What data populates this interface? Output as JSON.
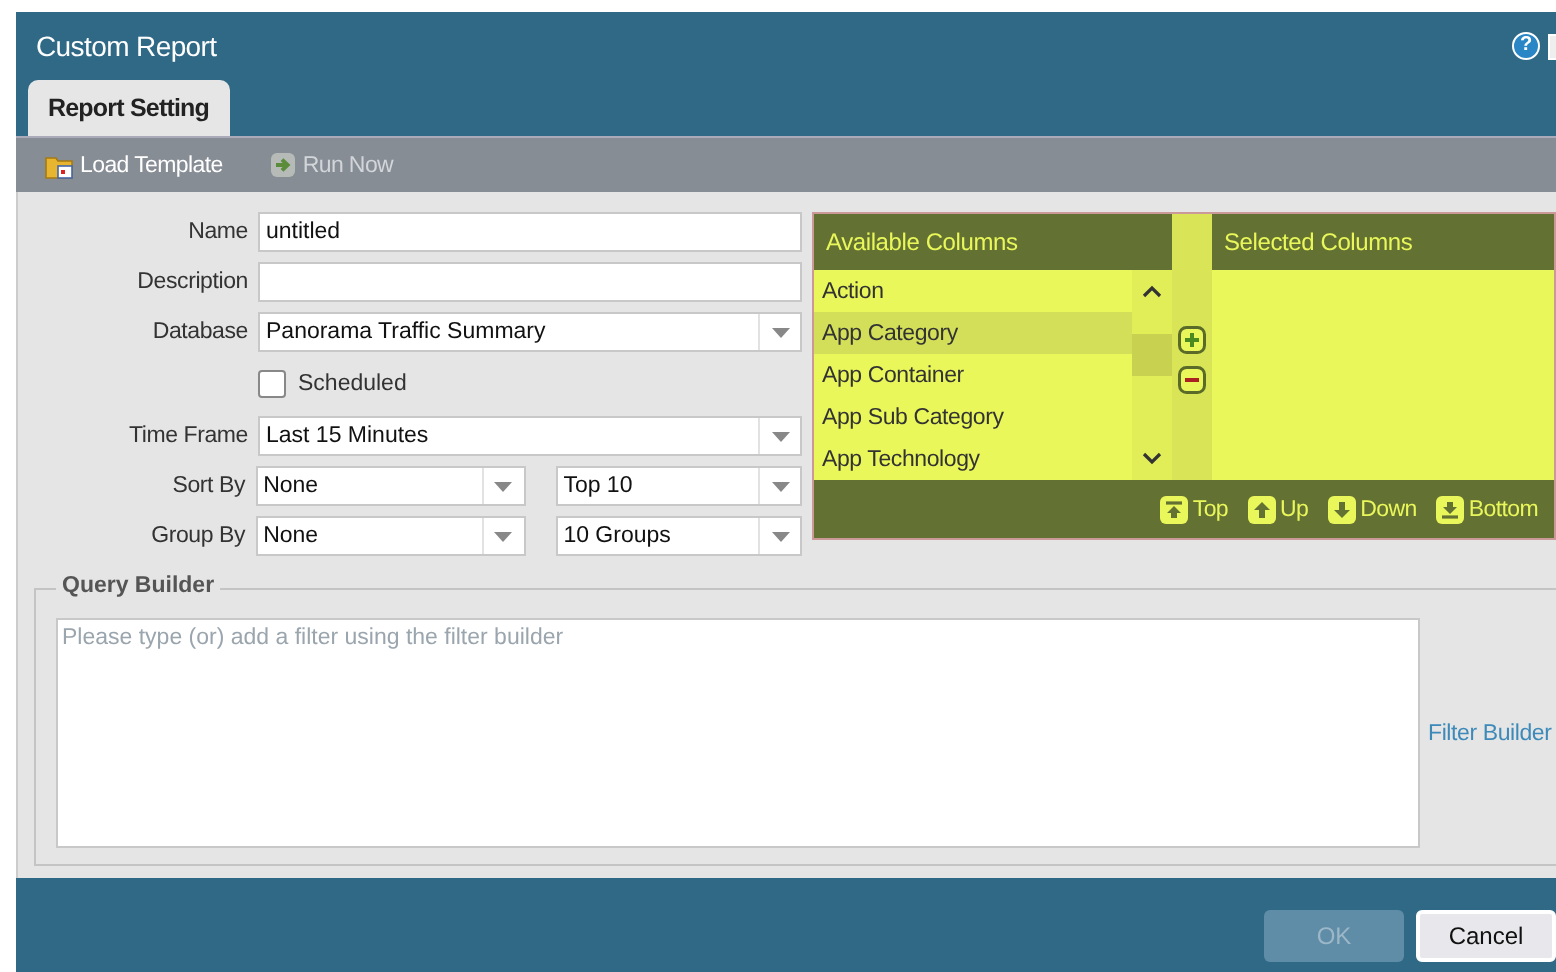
{
  "window": {
    "title": "Custom Report",
    "help": "?"
  },
  "tabs": [
    {
      "label": "Report Setting",
      "selected": true
    }
  ],
  "toolbar": [
    {
      "label": "Load Template",
      "disabled": false
    },
    {
      "label": "Run Now",
      "disabled": true
    }
  ],
  "form": {
    "fields": [
      {
        "kind": "text",
        "label": "Name",
        "value": "untitled"
      },
      {
        "kind": "text",
        "label": "Description"
      },
      {
        "kind": "select",
        "label": "Database",
        "value": "Panorama Traffic Summary"
      },
      {
        "kind": "checkbox",
        "label": "Scheduled",
        "checked": false
      },
      {
        "kind": "select",
        "label": "Time Frame",
        "value": "Last 15 Minutes"
      },
      {
        "kind": "select_pair",
        "label": "Sort By",
        "value": "None",
        "value2": "Top 10"
      },
      {
        "kind": "select_pair",
        "label": "Group By",
        "value": "None",
        "value2": "10 Groups"
      }
    ]
  },
  "columns": {
    "available_title": "Available Columns",
    "selected_title": "Selected Columns",
    "available": [
      {
        "label": "Action",
        "selected": false
      },
      {
        "label": "App Category",
        "selected": true
      },
      {
        "label": "App Container",
        "selected": false
      },
      {
        "label": "App Sub Category",
        "selected": false
      },
      {
        "label": "App Technology",
        "selected": false
      }
    ],
    "move_buttons": [
      {
        "label": "Top",
        "kind": "top"
      },
      {
        "label": "Up",
        "kind": "up"
      },
      {
        "label": "Down",
        "kind": "down"
      },
      {
        "label": "Bottom",
        "kind": "bottom"
      }
    ]
  },
  "query_builder": {
    "title": "Query Builder",
    "placeholder": "Please type (or) add a filter using the filter builder",
    "link": "Filter Builder"
  },
  "buttons": [
    {
      "label": "OK",
      "disabled": true
    },
    {
      "label": "Cancel",
      "disabled": false
    }
  ]
}
